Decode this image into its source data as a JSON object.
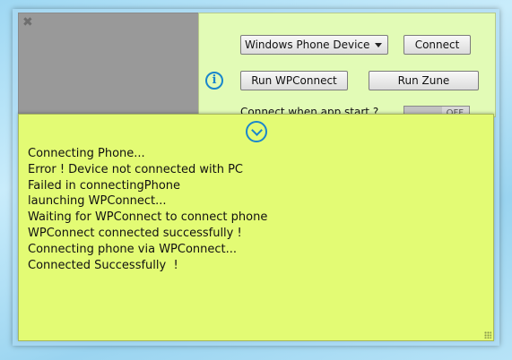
{
  "controls": {
    "device_select": {
      "selected": "Windows Phone Device"
    },
    "connect_label": "Connect",
    "run_wpconnect_label": "Run WPConnect",
    "run_zune_label": "Run Zune",
    "autostart_label": "Connect when app start ?",
    "autostart_toggle_text": "OFF"
  },
  "log": {
    "lines": [
      "Connecting Phone...",
      "Error ! Device not connected with PC",
      "Failed in connectingPhone",
      "launching WPConnect...",
      "Waiting for WPConnect to connect phone",
      "WPConnect connected successfully !",
      "Connecting phone via WPConnect...",
      "Connected Successfully  !"
    ]
  },
  "icons": {
    "close": "close-icon",
    "info": "info-icon",
    "collapse": "chevron-down-circle-icon",
    "resize": "resize-grip-icon"
  },
  "colors": {
    "control_panel_bg": "#e2fbb6",
    "log_panel_bg": "#e3fb74",
    "preview_bg": "#999999",
    "accent_icon": "#1a86cc"
  }
}
